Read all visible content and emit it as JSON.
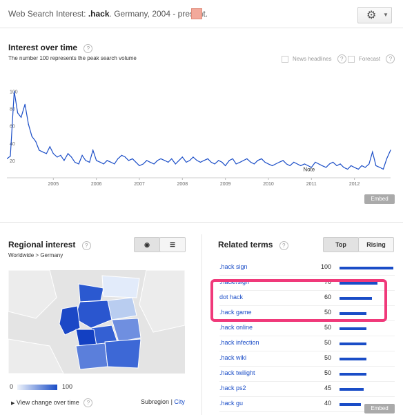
{
  "header": {
    "prefix": "Web Search Interest: ",
    "term": ".hack",
    "suffix": ". Germany, 2004 - present.",
    "gear_icon": "⚙",
    "caret_icon": "▼"
  },
  "interest_over_time": {
    "title": "Interest over time",
    "help": "?",
    "subtitle": "The number 100 represents the peak search volume",
    "news_headlines": "News headlines",
    "forecast": "Forecast",
    "embed": "Embed",
    "note_label": "Note",
    "chart_data": {
      "type": "line",
      "yticks": [
        20,
        40,
        60,
        80,
        100
      ],
      "xlabels": [
        "2005",
        "2006",
        "2007",
        "2008",
        "2009",
        "2010",
        "2011",
        "2012"
      ],
      "ylim": [
        0,
        110
      ],
      "xlim": [
        2004.0,
        2012.92
      ],
      "grid": false,
      "color": "#1a4dc7",
      "x": [
        2004.0,
        2004.08,
        2004.17,
        2004.25,
        2004.33,
        2004.42,
        2004.5,
        2004.58,
        2004.67,
        2004.75,
        2004.83,
        2004.92,
        2005.0,
        2005.08,
        2005.17,
        2005.25,
        2005.33,
        2005.42,
        2005.5,
        2005.58,
        2005.67,
        2005.75,
        2005.83,
        2005.92,
        2006.0,
        2006.08,
        2006.17,
        2006.25,
        2006.33,
        2006.42,
        2006.5,
        2006.58,
        2006.67,
        2006.75,
        2006.83,
        2006.92,
        2007.0,
        2007.08,
        2007.17,
        2007.25,
        2007.33,
        2007.42,
        2007.5,
        2007.58,
        2007.67,
        2007.75,
        2007.83,
        2007.92,
        2008.0,
        2008.08,
        2008.17,
        2008.25,
        2008.33,
        2008.42,
        2008.5,
        2008.58,
        2008.67,
        2008.75,
        2008.83,
        2008.92,
        2009.0,
        2009.08,
        2009.17,
        2009.25,
        2009.33,
        2009.42,
        2009.5,
        2009.58,
        2009.67,
        2009.75,
        2009.83,
        2009.92,
        2010.0,
        2010.08,
        2010.17,
        2010.25,
        2010.33,
        2010.42,
        2010.5,
        2010.58,
        2010.67,
        2010.75,
        2010.83,
        2010.92,
        2011.0,
        2011.08,
        2011.17,
        2011.25,
        2011.33,
        2011.42,
        2011.5,
        2011.58,
        2011.67,
        2011.75,
        2011.83,
        2011.92,
        2012.0,
        2012.08,
        2012.17,
        2012.25,
        2012.33,
        2012.42,
        2012.5,
        2012.58,
        2012.67,
        2012.75,
        2012.83,
        2012.92
      ],
      "values": [
        22,
        25,
        100,
        75,
        70,
        85,
        62,
        48,
        42,
        32,
        30,
        28,
        36,
        28,
        24,
        26,
        20,
        28,
        24,
        18,
        16,
        26,
        20,
        18,
        32,
        20,
        18,
        16,
        20,
        18,
        16,
        22,
        26,
        24,
        20,
        22,
        18,
        14,
        16,
        20,
        18,
        16,
        20,
        22,
        20,
        18,
        22,
        16,
        20,
        24,
        18,
        20,
        24,
        20,
        18,
        20,
        22,
        18,
        16,
        20,
        18,
        14,
        20,
        22,
        16,
        18,
        20,
        22,
        18,
        16,
        20,
        22,
        18,
        16,
        14,
        16,
        18,
        20,
        16,
        14,
        18,
        16,
        14,
        16,
        14,
        12,
        18,
        16,
        14,
        12,
        16,
        18,
        14,
        16,
        12,
        10,
        14,
        12,
        10,
        14,
        12,
        16,
        30,
        14,
        12,
        10,
        22,
        32
      ]
    }
  },
  "regional": {
    "title": "Regional interest",
    "help": "?",
    "breadcrumb": "Worldwide > Germany",
    "globe_icon": "◉",
    "list_icon": "☰",
    "legend_min": "0",
    "legend_max": "100",
    "view_change": "View change over time",
    "subregion": "Subregion",
    "separator": "|",
    "city": "City"
  },
  "related": {
    "title": "Related terms",
    "help": "?",
    "tab_top": "Top",
    "tab_rising": "Rising",
    "embed": "Embed",
    "terms": [
      {
        "label": ".hack sign",
        "value": 100
      },
      {
        "label": ".hack//sign",
        "value": 70
      },
      {
        "label": "dot hack",
        "value": 60
      },
      {
        "label": ".hack game",
        "value": 50
      },
      {
        "label": ".hack online",
        "value": 50
      },
      {
        "label": ".hack infection",
        "value": 50
      },
      {
        "label": ".hack wiki",
        "value": 50
      },
      {
        "label": ".hack twilight",
        "value": 50
      },
      {
        "label": ".hack ps2",
        "value": 45
      },
      {
        "label": ".hack gu",
        "value": 40
      }
    ]
  }
}
